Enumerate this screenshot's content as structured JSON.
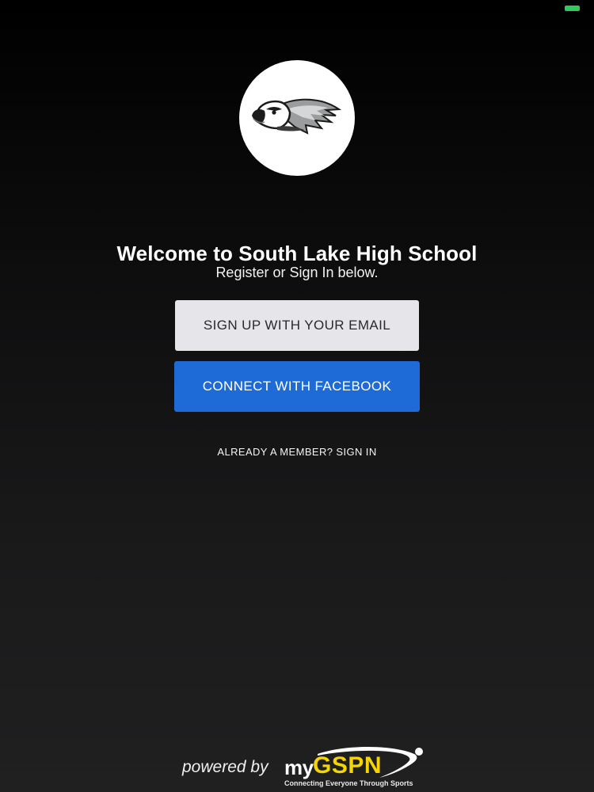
{
  "status_bar": {
    "battery_icon": "battery-icon",
    "battery_color": "#34c759"
  },
  "school": {
    "logo_icon": "eagle-mascot-icon"
  },
  "welcome": {
    "title": "Welcome to South Lake High School",
    "subtitle": "Register or Sign In below."
  },
  "actions": {
    "email_signup_label": "SIGN UP WITH YOUR EMAIL",
    "facebook_connect_label": "CONNECT WITH FACEBOOK",
    "sign_in_label": "ALREADY A MEMBER? SIGN IN"
  },
  "footer": {
    "powered_by": "powered by",
    "brand_prefix": "my",
    "brand_name": "GSPN",
    "brand_tagline": "Connecting Everyone Through Sports",
    "brand_color": "#f5d400"
  },
  "colors": {
    "facebook_blue": "#1e6ad6",
    "email_button_bg": "#e6e5ea"
  }
}
